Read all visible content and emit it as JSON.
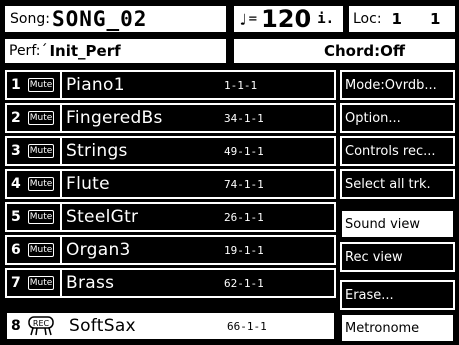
{
  "header": {
    "song_label": "Song:",
    "song_name": "SONG_02",
    "tempo_note": "♩",
    "tempo_eq": "=",
    "tempo_value": "120",
    "tempo_suffix": "i.",
    "loc_label": "Loc:",
    "loc_bar": "1",
    "loc_beat": "1",
    "perf_label": "Perf:´",
    "perf_name": "Init_Perf",
    "chord": "Chord:Off"
  },
  "tracks": [
    {
      "num": "1",
      "mute": "Mute",
      "name": "Piano1",
      "pos": "1-1-1"
    },
    {
      "num": "2",
      "mute": "Mute",
      "name": "FingeredBs",
      "pos": "34-1-1"
    },
    {
      "num": "3",
      "mute": "Mute",
      "name": "Strings",
      "pos": "49-1-1"
    },
    {
      "num": "4",
      "mute": "Mute",
      "name": "Flute",
      "pos": "74-1-1"
    },
    {
      "num": "5",
      "mute": "Mute",
      "name": "SteelGtr",
      "pos": "26-1-1"
    },
    {
      "num": "6",
      "mute": "Mute",
      "name": "Organ3",
      "pos": "19-1-1"
    },
    {
      "num": "7",
      "mute": "Mute",
      "name": "Brass",
      "pos": "62-1-1"
    },
    {
      "num": "8",
      "rec_icon": "record-icon",
      "name": "SoftSax",
      "pos": "66-1-1"
    }
  ],
  "buttons": [
    {
      "label": "Mode:Ovrdb..."
    },
    {
      "label": "Option..."
    },
    {
      "label": "Controls rec..."
    },
    {
      "label": "Select all trk."
    },
    {
      "label": "Sound view"
    },
    {
      "label": "Rec view"
    },
    {
      "label": "Erase..."
    },
    {
      "label": "Metronome"
    }
  ]
}
